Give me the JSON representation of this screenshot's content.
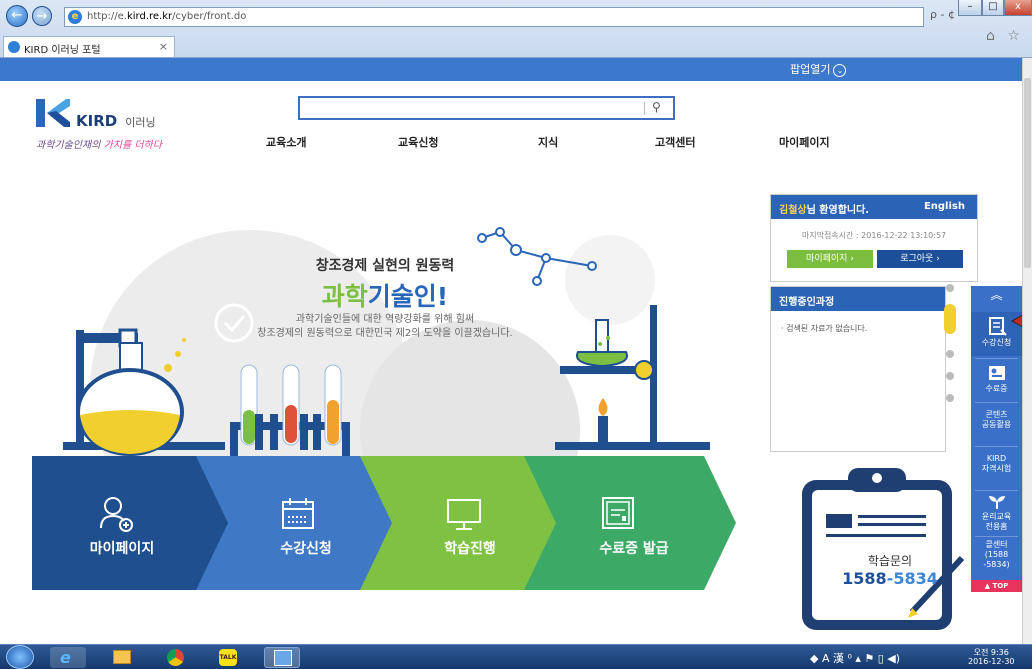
{
  "browser": {
    "url_prefix": "http://e.",
    "url_host": "kird.re.kr",
    "url_path": "/cyber/front.do",
    "addr_tools": "ρ - ¢",
    "tab_title": "KIRD 이러닝 포털",
    "tab_close": "×",
    "right_icons": "⌂ ☆ ⚙",
    "back": "←",
    "forward": "→",
    "win_min": "–",
    "win_max": "□",
    "win_close": "x"
  },
  "header": {
    "popup_label": "팝업열기",
    "popup_chevron": "⌄",
    "logo_brand": "KIRD",
    "logo_sub": "이러닝",
    "slogan_a": "과학기술인재의 ",
    "slogan_b": "가치를 더하다",
    "search_icon": "⚲"
  },
  "nav": {
    "items": [
      "교육소개",
      "교육신청",
      "지식",
      "고객센터",
      "마이페이지"
    ]
  },
  "hero": {
    "tagline": "창조경제 실현의 원동력",
    "title_a": "과학",
    "title_b": "기술인!",
    "desc_1": "과학기술인들에 대한 역량강화를 위해 힘써",
    "desc_2": "창조경제의 원동력으로 대한민국 제2의 도약을 이끌겠습니다."
  },
  "steps": [
    {
      "label": "마이페이지",
      "color": "#1f4f8f",
      "icon": "person-add-icon"
    },
    {
      "label": "수강신청",
      "color": "#3f78c5",
      "icon": "calendar-icon"
    },
    {
      "label": "학습진행",
      "color": "#7fc243",
      "icon": "monitor-icon"
    },
    {
      "label": "수료증 발급",
      "color": "#3da966",
      "icon": "certificate-icon"
    }
  ],
  "login": {
    "user_name": "김철상",
    "welcome_suffix": "님 환영합니다.",
    "lang": "English",
    "last_login": "마지막접속시간 : 2016-12-22 13:10:57",
    "mypage_btn": "마이페이지",
    "logout_btn": "로그아웃",
    "btn_arrow": "›"
  },
  "courses": {
    "title": "진행중인과정",
    "empty": "· 검색된 자료가 없습니다."
  },
  "quick_menu": {
    "up": "︽",
    "items": [
      {
        "label": "수강신청",
        "icon": "register-icon"
      },
      {
        "label": "수료증",
        "icon": "certificate-icon"
      },
      {
        "label": "콘텐츠\n공동활용",
        "icon": ""
      },
      {
        "label": "KIRD\n자격시험",
        "icon": ""
      },
      {
        "label": "윤리교육\n전용홈",
        "icon": "sprout-icon"
      },
      {
        "label": "콜센터\n(1588\n-5834)",
        "icon": ""
      }
    ],
    "top": "▲ TOP"
  },
  "contact": {
    "label": "학습문의",
    "phone_a": "1588",
    "phone_b": "-5834"
  },
  "taskbar": {
    "tray": "◆ A 漢 ⁰ ▴ ⚑ ▯ ◀)",
    "time": "오전 9:36",
    "date": "2016-12-30"
  },
  "colors": {
    "primary_blue": "#2b63b6",
    "green": "#7bc043",
    "quick_menu": "#3a70c8",
    "top_pink": "#e8345d"
  }
}
